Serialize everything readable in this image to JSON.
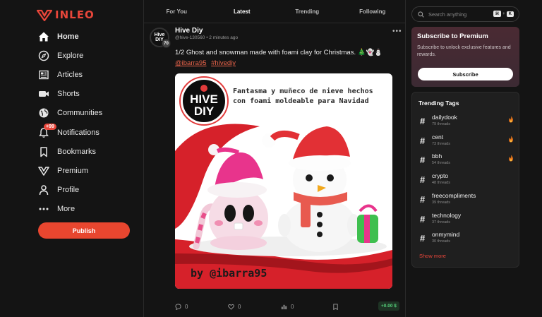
{
  "brand": {
    "name": "INLEO",
    "color": "#e8463a"
  },
  "nav": [
    {
      "label": "Home",
      "icon": "home-icon",
      "active": true
    },
    {
      "label": "Explore",
      "icon": "compass-icon"
    },
    {
      "label": "Articles",
      "icon": "newspaper-icon"
    },
    {
      "label": "Shorts",
      "icon": "video-camera-icon"
    },
    {
      "label": "Communities",
      "icon": "globe-icon"
    },
    {
      "label": "Notifications",
      "icon": "bell-icon",
      "badge": "+99"
    },
    {
      "label": "Bookmarks",
      "icon": "bookmark-icon"
    },
    {
      "label": "Premium",
      "icon": "premium-icon"
    },
    {
      "label": "Profile",
      "icon": "user-icon"
    },
    {
      "label": "More",
      "icon": "ellipsis-icon"
    }
  ],
  "publish_label": "Publish",
  "tabs": [
    {
      "label": "For You",
      "active": false
    },
    {
      "label": "Latest",
      "active": true
    },
    {
      "label": "Trending",
      "active": false
    },
    {
      "label": "Following",
      "active": false
    }
  ],
  "post": {
    "author": "Hive Diy",
    "handle": "@hive-130560",
    "time": "2 minutes ago",
    "level": "70",
    "avatar_text": "Hive DIY",
    "text": "1/2 Ghost and snowman made with foami clay for Christmas. 🎄👻⛄",
    "tags": [
      "@ibarra95",
      "#hivediy"
    ],
    "image": {
      "logo_line1": "HIVE",
      "logo_line2": "DIY",
      "title": "Fantasma y muñeco de nieve hechos con foami moldeable para Navidad",
      "byline": "by @ibarra95"
    },
    "comments": "0",
    "likes": "0",
    "views": "0",
    "payout": "+0.00 $"
  },
  "search": {
    "placeholder": "Search anything",
    "shortcut_key1": "⌘",
    "shortcut_plus": "+",
    "shortcut_key2": "K"
  },
  "premium": {
    "title": "Subscribe to Premium",
    "desc": "Subscribe to unlock exclusive features and rewards.",
    "button": "Subscribe"
  },
  "trending": {
    "title": "Trending Tags",
    "tags": [
      {
        "name": "dailydook",
        "count": "79 threads",
        "hot": true
      },
      {
        "name": "cent",
        "count": "73 threads",
        "hot": true
      },
      {
        "name": "bbh",
        "count": "54 threads",
        "hot": true
      },
      {
        "name": "crypto",
        "count": "48 threads",
        "hot": false
      },
      {
        "name": "freecompliments",
        "count": "39 threads",
        "hot": false
      },
      {
        "name": "technology",
        "count": "37 threads",
        "hot": false
      },
      {
        "name": "onmymind",
        "count": "30 threads",
        "hot": false
      }
    ],
    "show_more": "Show more"
  }
}
